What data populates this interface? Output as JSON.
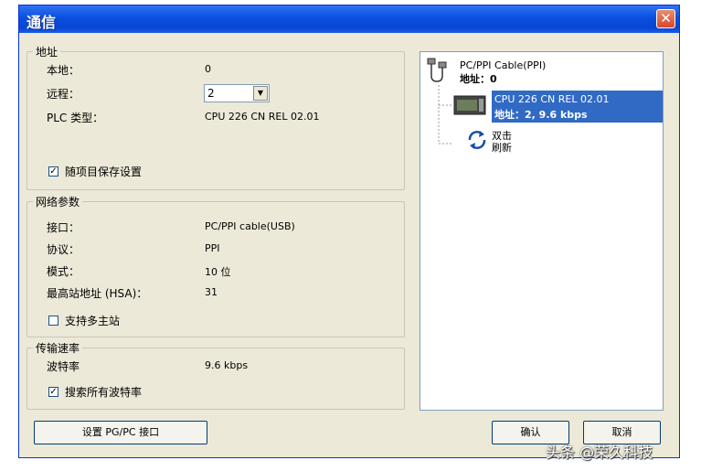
{
  "window": {
    "title": "通信",
    "close_glyph": "✕"
  },
  "address": {
    "legend": "地址",
    "local_label": "本地：",
    "local_value": "0",
    "remote_label": "远程：",
    "remote_value": "2",
    "plc_label": "PLC 类型：",
    "plc_value": "CPU 226 CN REL 02.01",
    "save_label": "随项目保存设置",
    "save_checked": true
  },
  "network": {
    "legend": "网络参数",
    "interface_label": "接口：",
    "interface_value": "PC/PPI cable(USB)",
    "protocol_label": "协议：",
    "protocol_value": "PPI",
    "mode_label": "模式：",
    "mode_value": "10 位",
    "hsa_label": "最高站地址 (HSA)：",
    "hsa_value": "31",
    "multimaster_label": "支持多主站",
    "multimaster_checked": false
  },
  "transmission": {
    "legend": "传输速率",
    "baud_label": "波特率",
    "baud_value": "9.6 kbps",
    "search_label": "搜索所有波特率",
    "search_checked": true
  },
  "tree": {
    "cable_name": "PC/PPI Cable(PPI)",
    "cable_addr": "地址：0",
    "cpu_name": "CPU 226 CN REL 02.01",
    "cpu_addr": "地址：2, 9.6 kbps",
    "refresh_line1": "双击",
    "refresh_line2": "刷新"
  },
  "buttons": {
    "set_pgpc": "设置 PG/PC 接口",
    "ok": "确认",
    "cancel": "取消"
  },
  "watermark": "头条 @荣久科技",
  "colors": {
    "titlebar": "#0a4fe0",
    "selection": "#316ac5",
    "dialog_bg": "#ece9d8"
  }
}
